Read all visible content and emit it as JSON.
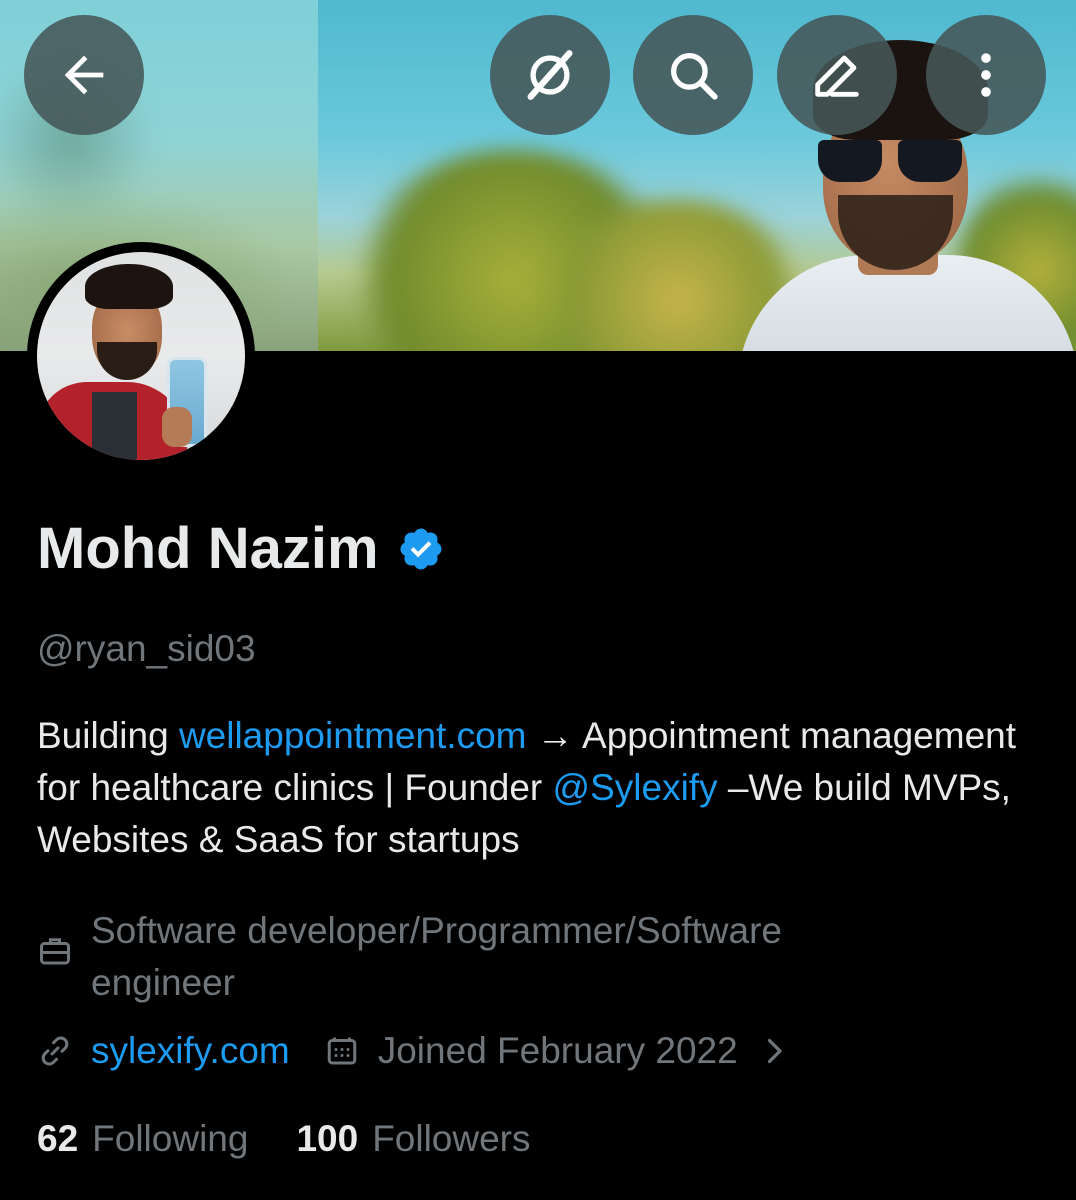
{
  "header": {
    "back_icon": "arrow-left-icon",
    "grok_icon": "grok-icon",
    "search_icon": "search-icon",
    "edit_icon": "edit-pencil-icon",
    "more_icon": "more-vertical-icon"
  },
  "profile": {
    "display_name": "Mohd Nazim",
    "verified": true,
    "verified_color": "#1d9bf0",
    "handle": "@ryan_sid03",
    "bio": {
      "part1": "Building ",
      "link1": "wellappointment.com",
      "part2": " → Appointment management for healthcare clinics | Founder ",
      "link2": "@Sylexify",
      "part3": " –We build MVPs, Websites & SaaS for startups"
    },
    "profession": "Software developer/Programmer/Software engineer",
    "website": "sylexify.com",
    "joined": "Joined February 2022"
  },
  "stats": {
    "following_count": "62",
    "following_label": "Following",
    "followers_count": "100",
    "followers_label": "Followers"
  },
  "colors": {
    "background": "#000000",
    "text_primary": "#e7e9ea",
    "text_secondary": "#71767b",
    "accent": "#1d9bf0"
  }
}
